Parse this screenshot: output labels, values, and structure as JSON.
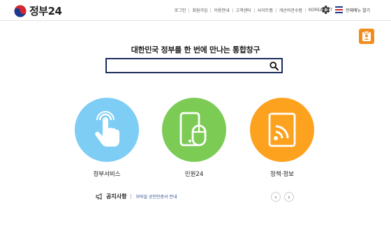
{
  "header": {
    "logo_text": "정부24",
    "util_links": [
      "로그인",
      "회원가입",
      "이용안내",
      "고객센터",
      "사이트맵",
      "개선의견수렴",
      "KOREA.NET"
    ],
    "full_menu_label": "전체메뉴 열기"
  },
  "main": {
    "tagline": "대한민국 정부를 한 번에 만나는 통합창구",
    "search": {
      "value": "",
      "placeholder": ""
    },
    "services": [
      {
        "label": "정부서비스",
        "icon": "touch-hand-icon",
        "color": "#7ecdf5"
      },
      {
        "label": "민원24",
        "icon": "phone-mouse-icon",
        "color": "#7ccb55"
      },
      {
        "label": "정책·정보",
        "icon": "tablet-signal-icon",
        "color": "#fda21f"
      }
    ]
  },
  "notice": {
    "title": "공지사항",
    "item": "모바일 공인인증서 안내",
    "prev_symbol": "‹",
    "next_symbol": "›"
  },
  "colors": {
    "accent": "#1b2d5b",
    "side_badge": "#f28c1a"
  }
}
